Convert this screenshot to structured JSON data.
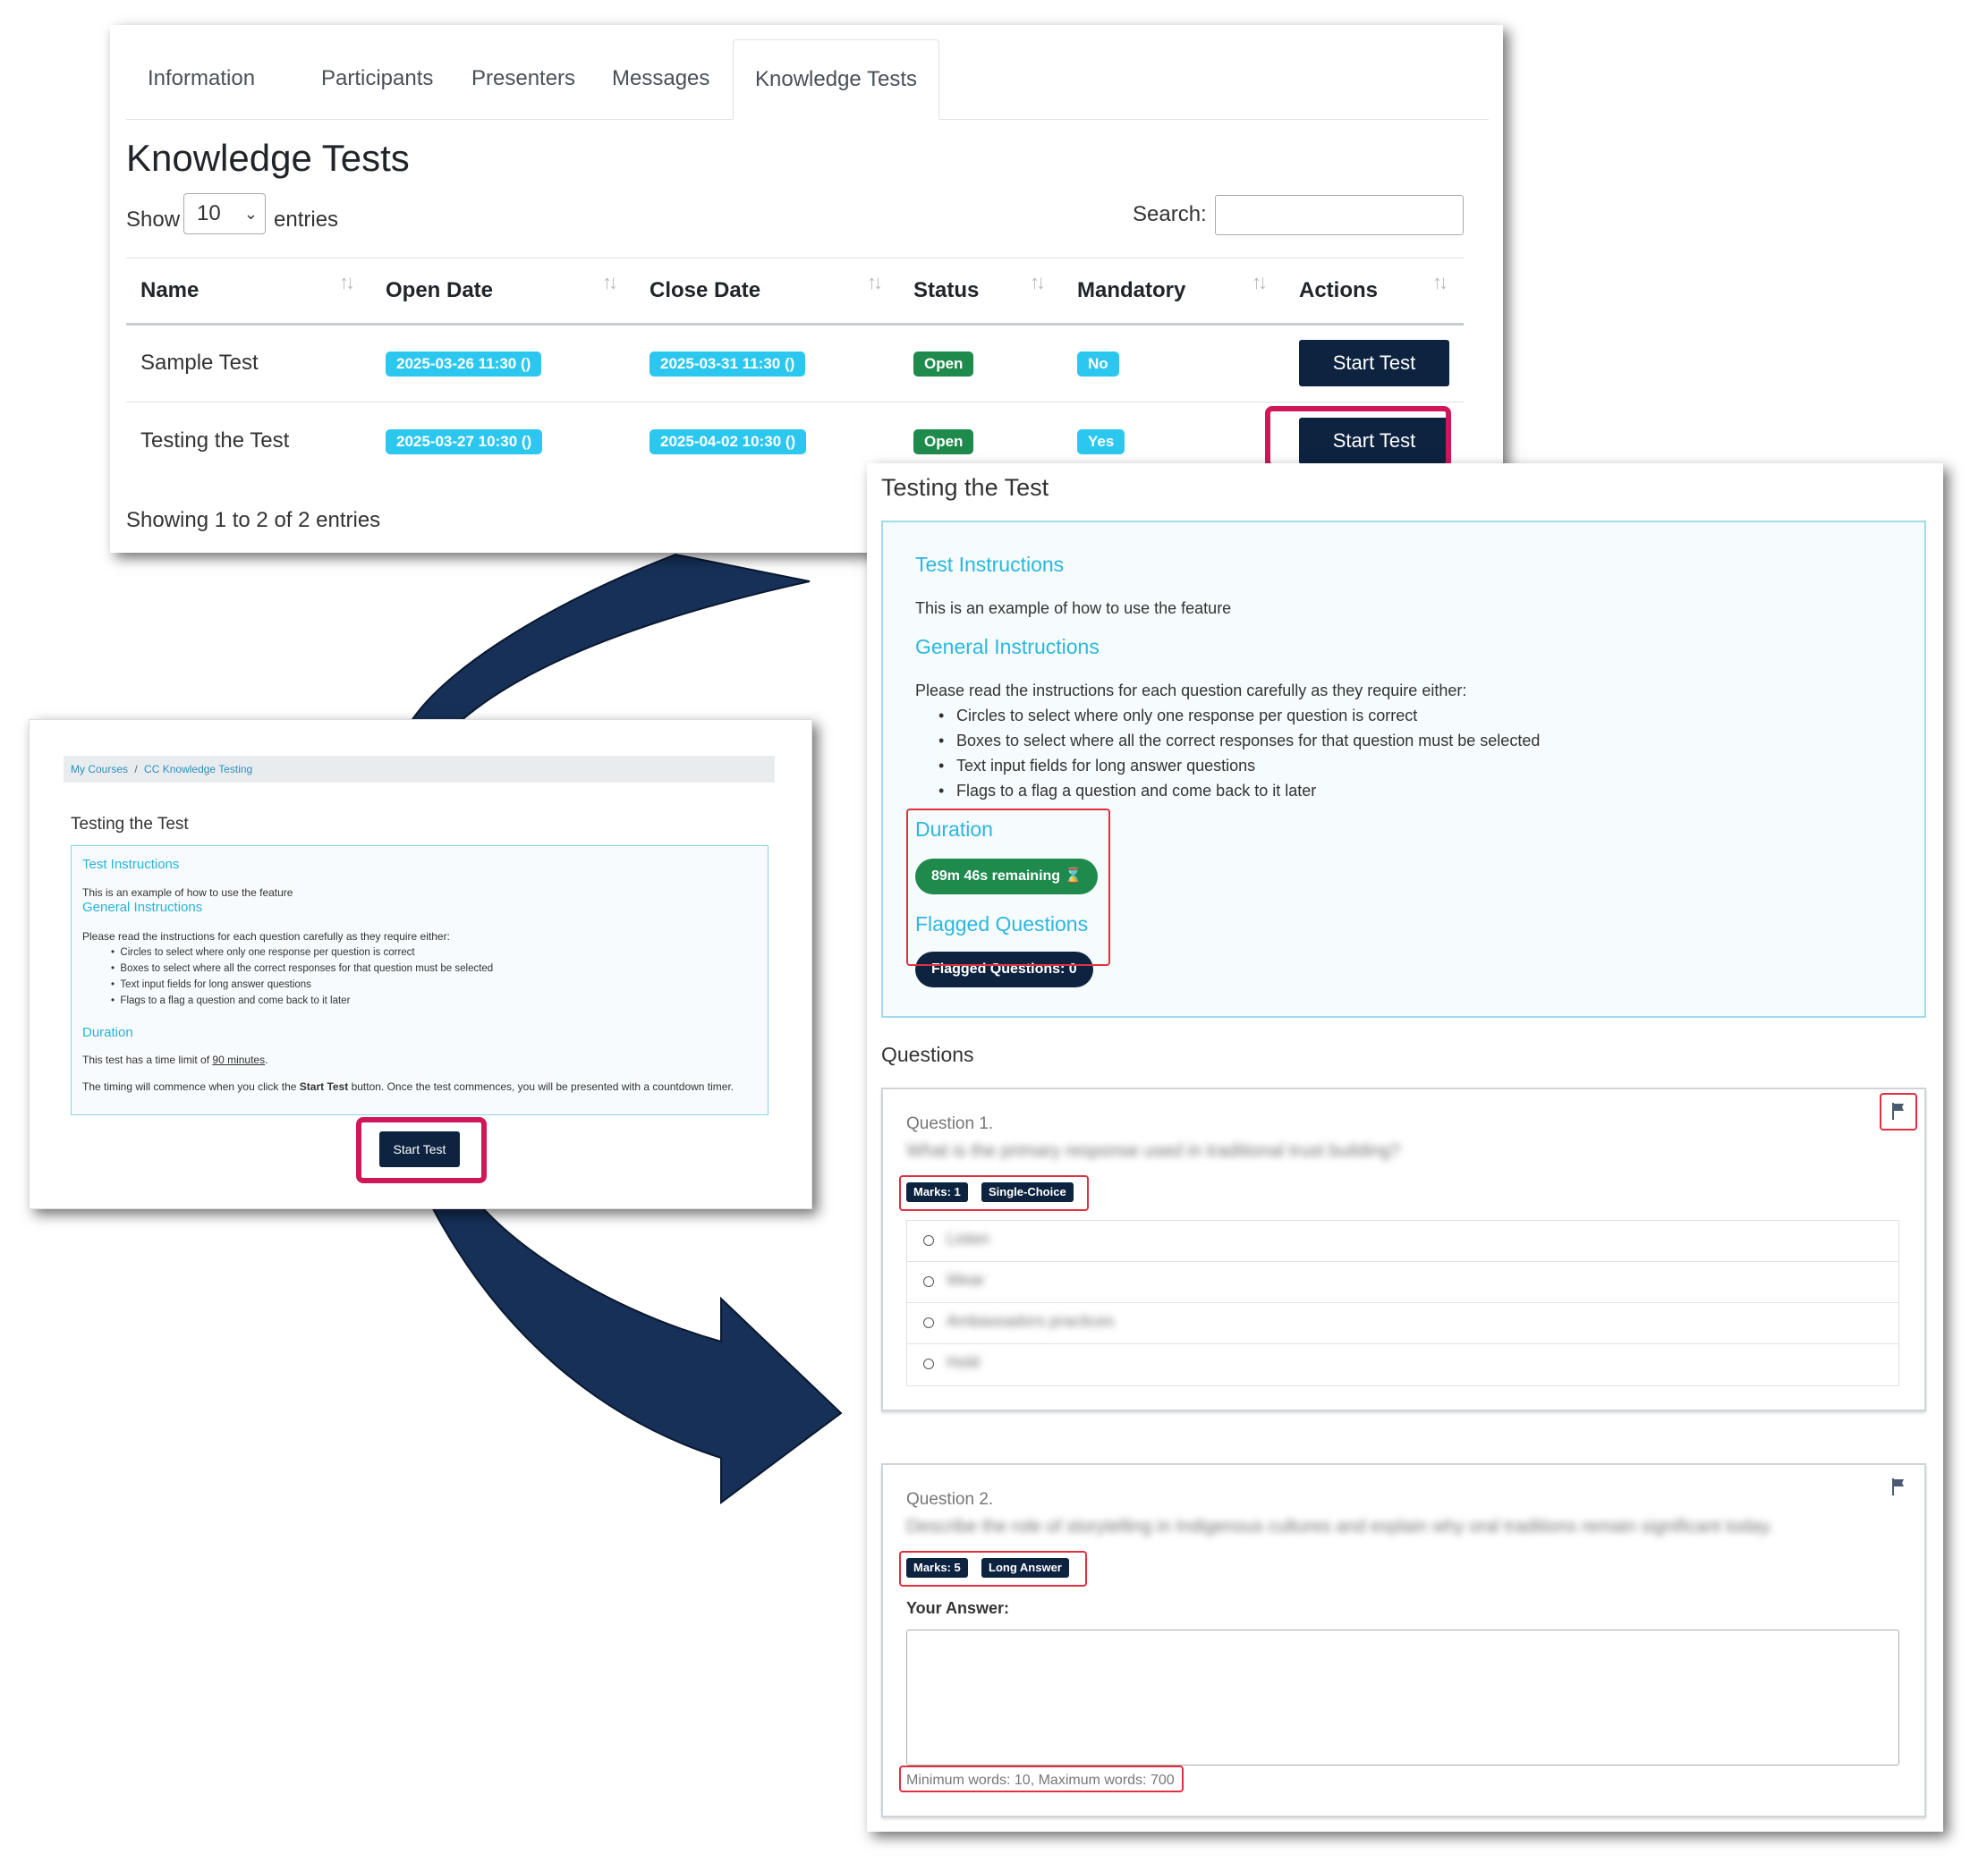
{
  "list_page": {
    "tabs": [
      "Information",
      "Participants",
      "Presenters",
      "Messages",
      "Knowledge Tests"
    ],
    "active_tab": "Knowledge Tests",
    "title": "Knowledge Tests",
    "show_label": "Show",
    "show_value": "10",
    "entries_label": "entries",
    "search_label": "Search:",
    "columns": [
      "Name",
      "Open Date",
      "Close Date",
      "Status",
      "Mandatory",
      "Actions"
    ],
    "sort_glyph": "↑↓",
    "rows": [
      {
        "name": "Sample Test",
        "open_date": "2025-03-26 11:30 ()",
        "close_date": "2025-03-31 11:30 ()",
        "status": "Open",
        "mandatory": "No",
        "action": "Start Test"
      },
      {
        "name": "Testing the Test",
        "open_date": "2025-03-27 10:30 ()",
        "close_date": "2025-04-02 10:30 ()",
        "status": "Open",
        "mandatory": "Yes",
        "action": "Start Test"
      }
    ],
    "footer": "Showing 1 to 2 of 2 entries"
  },
  "preview_page": {
    "breadcrumb": [
      "My Courses",
      "CC Knowledge Testing"
    ],
    "breadcrumb_sep": "/",
    "title": "Testing the Test",
    "test_instructions_heading": "Test Instructions",
    "test_instructions_text": "This is an example of how to use the feature",
    "general_heading": "General Instructions",
    "general_intro": "Please read the instructions for each question carefully as they require either:",
    "general_items": [
      "Circles to select where only one response per question is correct",
      "Boxes to select where all the correct responses for that question must be selected",
      "Text input fields for long answer questions",
      "Flags to a flag a question and come back to it later"
    ],
    "duration_heading": "Duration",
    "time_limit_prefix": "This test has a time limit of ",
    "time_limit_value": "90 minutes",
    "time_limit_suffix": ".",
    "timing_prefix": "The timing will commence when you click the ",
    "timing_bold": "Start Test",
    "timing_suffix": " button. Once the test commences, you will be presented with a countdown timer.",
    "start_button": "Start Test"
  },
  "test_page": {
    "title": "Testing the Test",
    "test_instructions_heading": "Test Instructions",
    "test_instructions_text": "This is an example of how to use the feature",
    "general_heading": "General Instructions",
    "general_intro": "Please read the instructions for each question carefully as they require either:",
    "general_items": [
      "Circles to select where only one response per question is correct",
      "Boxes to select where all the correct responses for that question must be selected",
      "Text input fields for long answer questions",
      "Flags to a flag a question and come back to it later"
    ],
    "duration_heading": "Duration",
    "remaining": "89m 46s remaining ⌛",
    "flagged_heading": "Flagged Questions",
    "flagged_button": "Flagged Questions: 0",
    "questions_heading": "Questions",
    "questions": [
      {
        "number": "Question 1.",
        "text": "What is the primary response used in traditional trust building?",
        "marks": "Marks: 1",
        "type": "Single-Choice",
        "options": [
          "Listen",
          "Wear",
          "Ambassadors practices",
          "Hold"
        ]
      },
      {
        "number": "Question 2.",
        "text": "Describe the role of storytelling in Indigenous cultures and explain why oral traditions remain significant today.",
        "marks": "Marks: 5",
        "type": "Long Answer",
        "answer_label": "Your Answer:",
        "word_limits": "Minimum words: 10, Maximum words: 700"
      }
    ]
  },
  "colors": {
    "navy": "#0d2340",
    "info_badge": "#2cc7ef",
    "success": "#1e8a4c",
    "heading_cyan": "#2bb7df",
    "highlight_pink": "#d0175a",
    "highlight_red": "#e03040",
    "arrow": "#163057"
  }
}
